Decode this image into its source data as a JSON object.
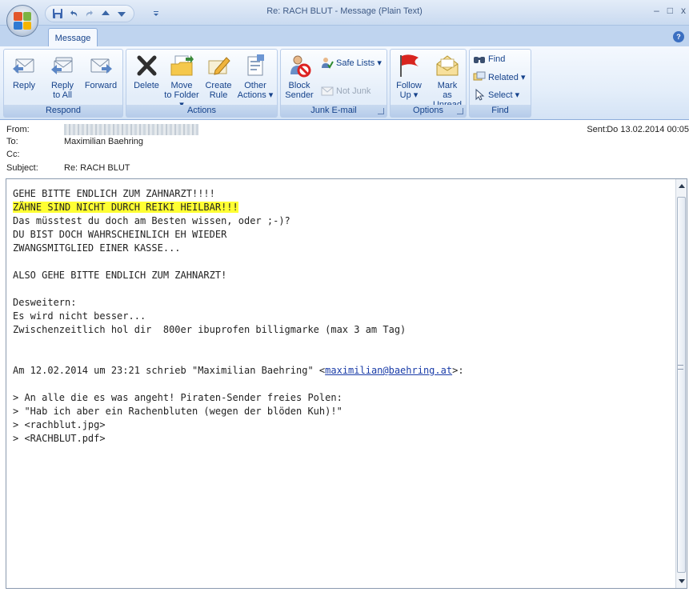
{
  "window": {
    "title": "Re: RACH BLUT - Message (Plain Text)",
    "controls": {
      "minimize": "–",
      "maximize": "□",
      "close": "x"
    }
  },
  "quick_access": [
    "save-icon",
    "undo-icon",
    "redo-icon",
    "previous-item-icon",
    "next-item-icon",
    "customize-icon"
  ],
  "tabs": [
    {
      "label": "Message"
    }
  ],
  "ribbon": {
    "groups": [
      {
        "label": "Respond",
        "buttons": [
          {
            "label": "Reply",
            "icon": "reply-icon"
          },
          {
            "label": "Reply to All",
            "icon": "reply-all-icon"
          },
          {
            "label": "Forward",
            "icon": "forward-icon"
          }
        ]
      },
      {
        "label": "Actions",
        "buttons": [
          {
            "label": "Delete",
            "icon": "delete-icon"
          },
          {
            "label": "Move to Folder ▾",
            "icon": "move-to-folder-icon"
          },
          {
            "label": "Create Rule",
            "icon": "create-rule-icon"
          },
          {
            "label": "Other Actions ▾",
            "icon": "other-actions-icon"
          }
        ]
      },
      {
        "label": "Junk E-mail",
        "buttons": [
          {
            "label": "Block Sender",
            "icon": "block-sender-icon"
          },
          {
            "label": "Safe Lists ▾",
            "icon": "safe-lists-icon"
          },
          {
            "label": "Not Junk",
            "icon": "not-junk-icon",
            "disabled": true
          }
        ]
      },
      {
        "label": "Options",
        "buttons": [
          {
            "label": "Follow Up ▾",
            "icon": "flag-icon"
          },
          {
            "label": "Mark as Unread",
            "icon": "mark-unread-icon"
          }
        ]
      },
      {
        "label": "Find",
        "buttons": [
          {
            "label": "Find",
            "icon": "find-icon"
          },
          {
            "label": "Related ▾",
            "icon": "related-icon"
          },
          {
            "label": "Select ▾",
            "icon": "select-icon"
          }
        ]
      }
    ]
  },
  "header": {
    "from_label": "From:",
    "to_label": "To:",
    "to_value": "Maximilian Baehring",
    "cc_label": "Cc:",
    "subject_label": "Subject:",
    "subject_value": "Re: RACH BLUT",
    "sent_label": "Sent:",
    "sent_value": "Do 13.02.2014 00:05"
  },
  "message": {
    "lines": [
      "GEHE BITTE ENDLICH ZUM ZAHNARZT!!!!",
      "ZÄHNE SIND NICHT DURCH REIKI HEILBAR!!!",
      "Das müsstest du doch am Besten wissen, oder ;-)?",
      "DU BIST DOCH WAHRSCHEINLICH EH WIEDER",
      "ZWANGSMITGLIED EINER KASSE...",
      "",
      "ALSO GEHE BITTE ENDLICH ZUM ZAHNARZT!",
      "",
      "Desweitern:",
      "Es wird nicht besser...",
      "Zwischenzeitlich hol dir  800er ibuprofen billigmarke (max 3 am Tag)",
      "",
      "",
      "Am 12.02.2014 um 23:21 schrieb \"Maximilian Baehring\" <maximilian@baehring.at>:",
      "",
      "> An alle die es was angeht! Piraten-Sender freies Polen:",
      "> \"Hab ich aber ein Rachenbluten (wegen der blöden Kuh)!\"",
      "> <rachblut.jpg>",
      "> <RACHBLUT.pdf>"
    ],
    "highlighted_line": 1,
    "quote_intro_prefix": "Am 12.02.2014 um 23:21 schrieb \"Maximilian Baehring\" <",
    "quote_email": "maximilian@baehring.at",
    "quote_intro_suffix": ">:",
    "highlight_color": "#ffff33"
  }
}
